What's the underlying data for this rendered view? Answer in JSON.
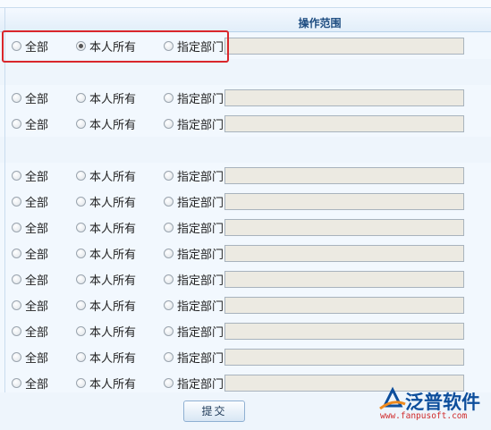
{
  "header": {
    "title": "操作范围"
  },
  "options": {
    "all": "全部",
    "own": "本人所有",
    "dept": "指定部门"
  },
  "rows": [
    {
      "selected": "own"
    },
    null,
    {
      "selected": "none"
    },
    {
      "selected": "none"
    },
    null,
    {
      "selected": "none"
    },
    {
      "selected": "none"
    },
    {
      "selected": "none"
    },
    {
      "selected": "none"
    },
    {
      "selected": "none"
    },
    {
      "selected": "none"
    },
    {
      "selected": "none"
    },
    {
      "selected": "none"
    },
    {
      "selected": "none"
    }
  ],
  "submit_label": "提交",
  "logo": {
    "brand": "泛普软件",
    "url": "www.fanpusoft.com"
  },
  "colors": {
    "highlight": "#d9262b",
    "brand": "#0d4e9c"
  }
}
